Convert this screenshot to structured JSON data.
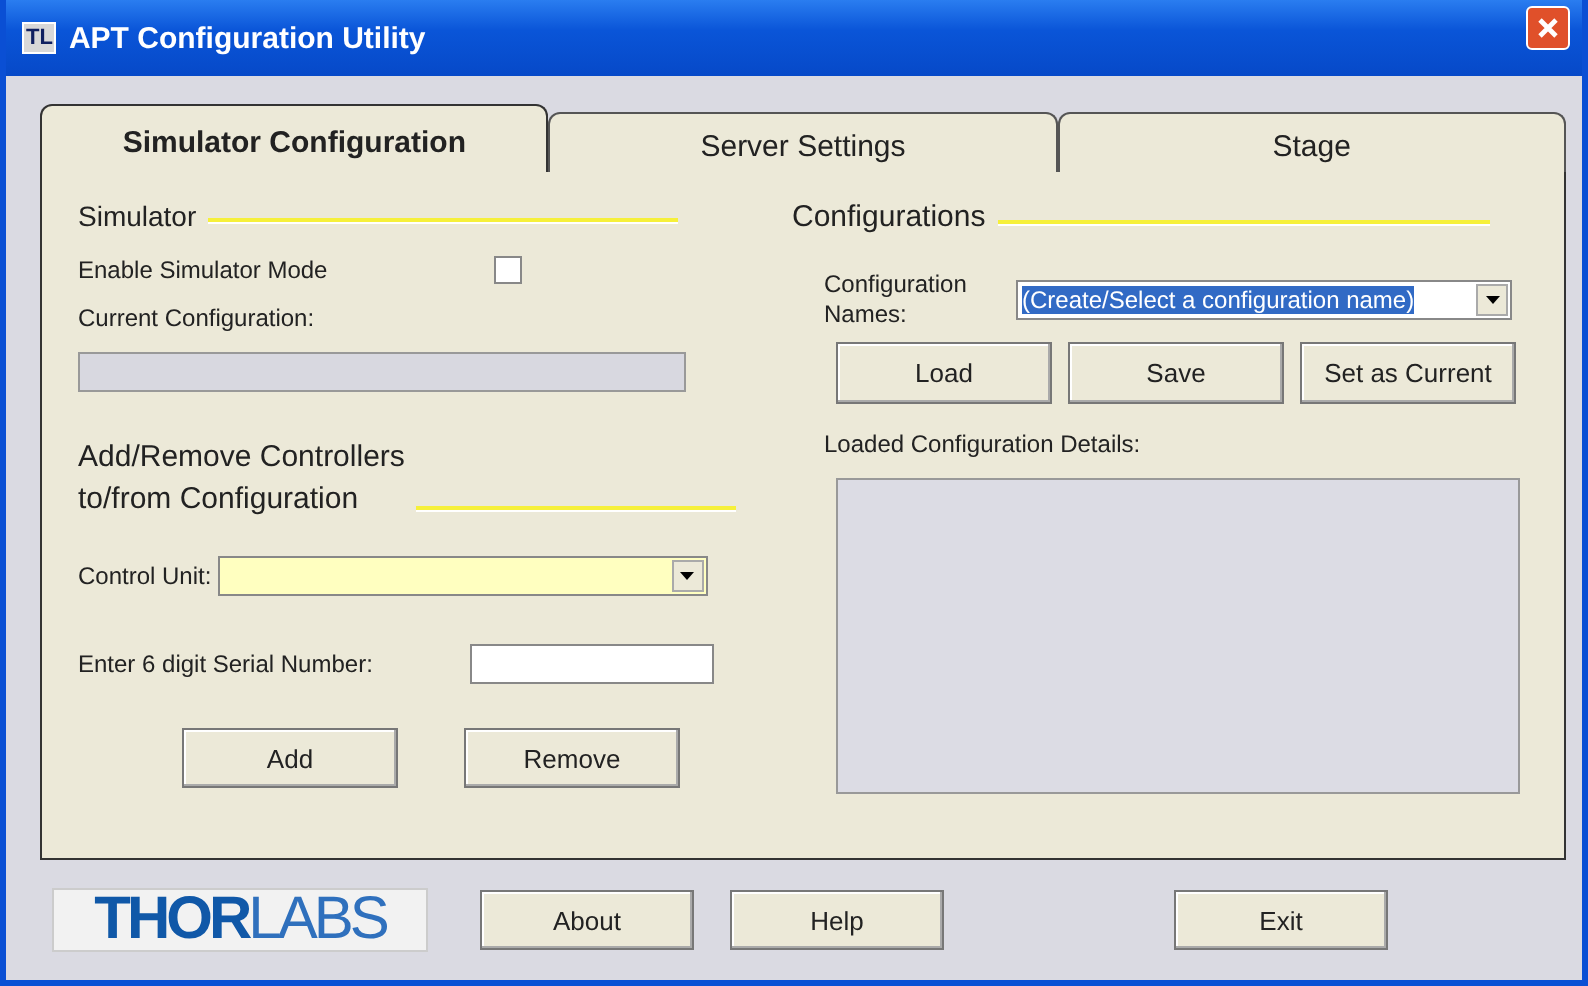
{
  "window": {
    "title": "APT Configuration Utility",
    "app_icon": "TL"
  },
  "tabs": [
    {
      "label": "Simulator Configuration",
      "selected": true
    },
    {
      "label": "Server Settings",
      "selected": false
    },
    {
      "label": "Stage",
      "selected": false
    }
  ],
  "simulator": {
    "heading": "Simulator",
    "enable_label": "Enable Simulator Mode",
    "enable_checked": false,
    "current_label": "Current Configuration:"
  },
  "controllers": {
    "heading_line1": "Add/Remove Controllers",
    "heading_line2": "to/from Configuration",
    "control_unit_label": "Control Unit:",
    "serial_label": "Enter 6 digit Serial Number:",
    "buttons": [
      "Add",
      "Remove"
    ]
  },
  "configurations": {
    "heading": "Configurations",
    "names_label": "Configuration Names:",
    "names_value": "(Create/Select a configuration name)",
    "buttons": [
      "Load",
      "Save",
      "Set as Current"
    ],
    "details_label": "Loaded Configuration Details:"
  },
  "footer": {
    "logo_bold": "THOR",
    "logo_light": "LABS",
    "buttons": [
      "About",
      "Help",
      "Exit"
    ]
  }
}
